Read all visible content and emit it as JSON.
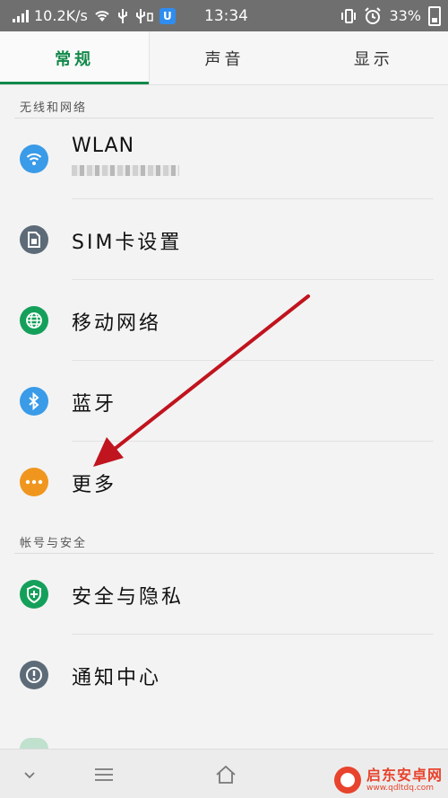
{
  "status_bar": {
    "speed": "10.2K/s",
    "time": "13:34",
    "battery": "33%"
  },
  "tabs": [
    {
      "label": "常规",
      "active": true
    },
    {
      "label": "声音",
      "active": false
    },
    {
      "label": "显示",
      "active": false
    }
  ],
  "sections": {
    "wireless": "无线和网络",
    "account": "帐号与安全"
  },
  "items": [
    {
      "label": "WLAN",
      "sub": "",
      "icon": "wifi-icon",
      "color": "#3a9be8"
    },
    {
      "label": "SIM卡设置",
      "icon": "sim-card-icon",
      "color": "#5d6b78"
    },
    {
      "label": "移动网络",
      "icon": "globe-icon",
      "color": "#14a05a"
    },
    {
      "label": "蓝牙",
      "icon": "bluetooth-icon",
      "color": "#3a9be8"
    },
    {
      "label": "更多",
      "icon": "more-icon",
      "color": "#f0961e"
    },
    {
      "label": "安全与隐私",
      "icon": "shield-icon",
      "color": "#14a05a"
    },
    {
      "label": "通知中心",
      "icon": "notification-icon",
      "color": "#5d6b78"
    }
  ],
  "annotation": {
    "color": "#c0141e"
  },
  "watermark": {
    "title": "启东安卓网",
    "url": "www.qdltdq.com"
  }
}
